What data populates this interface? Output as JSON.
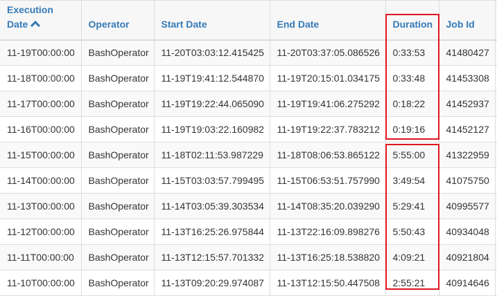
{
  "headers": {
    "execution_date_line1": "Execution",
    "execution_date_line2": "Date",
    "operator": "Operator",
    "start_date": "Start Date",
    "end_date": "End Date",
    "duration": "Duration",
    "job_id": "Job Id"
  },
  "sort_icon": "chevron-up-icon",
  "highlight_color": "#e0141e",
  "rows": [
    {
      "execution_date": "11-19T00:00:00",
      "operator": "BashOperator",
      "start_date": "11-20T03:03:12.415425",
      "end_date": "11-20T03:37:05.086526",
      "duration": "0:33:53",
      "job_id": "41480427"
    },
    {
      "execution_date": "11-18T00:00:00",
      "operator": "BashOperator",
      "start_date": "11-19T19:41:12.544870",
      "end_date": "11-19T20:15:01.034175",
      "duration": "0:33:48",
      "job_id": "41453308"
    },
    {
      "execution_date": "11-17T00:00:00",
      "operator": "BashOperator",
      "start_date": "11-19T19:22:44.065090",
      "end_date": "11-19T19:41:06.275292",
      "duration": "0:18:22",
      "job_id": "41452937"
    },
    {
      "execution_date": "11-16T00:00:00",
      "operator": "BashOperator",
      "start_date": "11-19T19:03:22.160982",
      "end_date": "11-19T19:22:37.783212",
      "duration": "0:19:16",
      "job_id": "41452127"
    },
    {
      "execution_date": "11-15T00:00:00",
      "operator": "BashOperator",
      "start_date": "11-18T02:11:53.987229",
      "end_date": "11-18T08:06:53.865122",
      "duration": "5:55:00",
      "job_id": "41322959"
    },
    {
      "execution_date": "11-14T00:00:00",
      "operator": "BashOperator",
      "start_date": "11-15T03:03:57.799495",
      "end_date": "11-15T06:53:51.757990",
      "duration": "3:49:54",
      "job_id": "41075750"
    },
    {
      "execution_date": "11-13T00:00:00",
      "operator": "BashOperator",
      "start_date": "11-14T03:05:39.303534",
      "end_date": "11-14T08:35:20.039290",
      "duration": "5:29:41",
      "job_id": "40995577"
    },
    {
      "execution_date": "11-12T00:00:00",
      "operator": "BashOperator",
      "start_date": "11-13T16:25:26.975844",
      "end_date": "11-13T22:16:09.898276",
      "duration": "5:50:43",
      "job_id": "40934048"
    },
    {
      "execution_date": "11-11T00:00:00",
      "operator": "BashOperator",
      "start_date": "11-13T12:15:57.701332",
      "end_date": "11-13T16:25:18.538820",
      "duration": "4:09:21",
      "job_id": "40921804"
    },
    {
      "execution_date": "11-10T00:00:00",
      "operator": "BashOperator",
      "start_date": "11-13T09:20:29.974087",
      "end_date": "11-13T12:15:50.447508",
      "duration": "2:55:21",
      "job_id": "40914646"
    }
  ]
}
